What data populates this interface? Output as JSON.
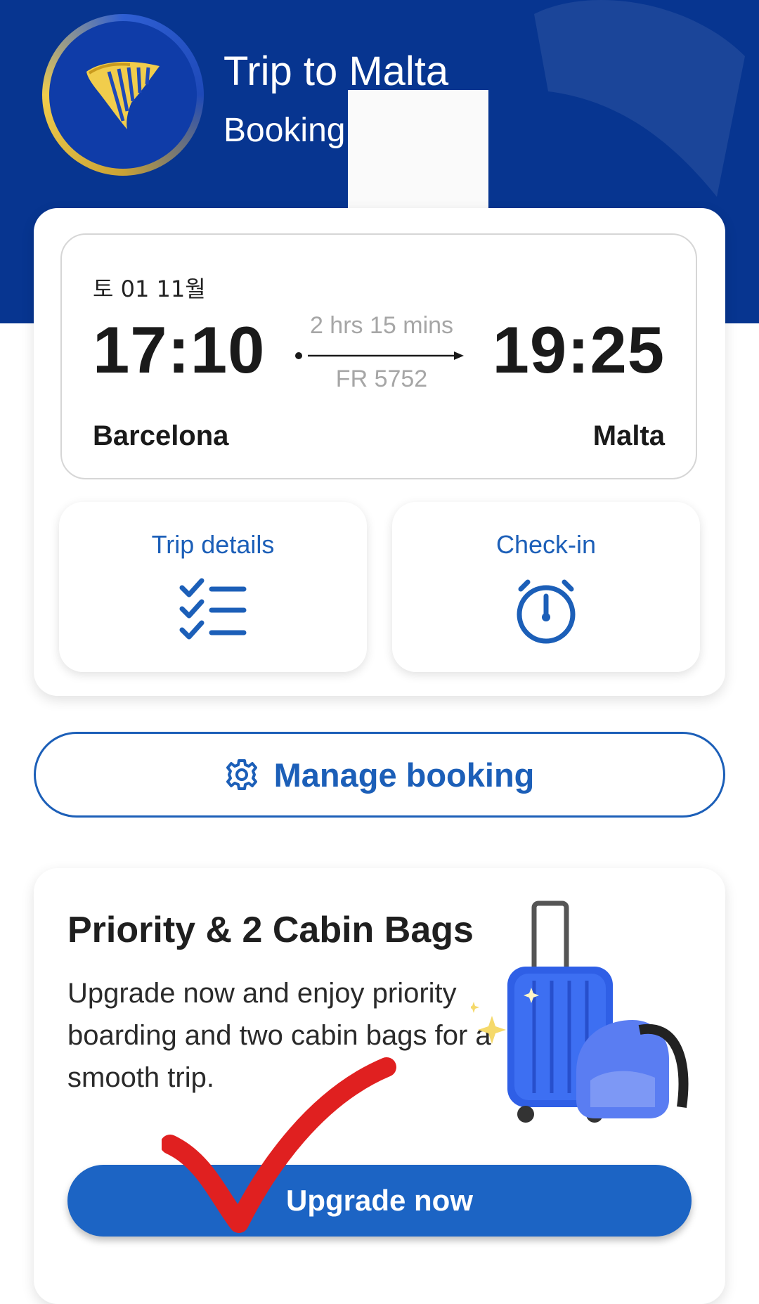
{
  "header": {
    "title": "Trip to Malta",
    "subtitle": "Booking",
    "logo_icon": "ryanair-harp-icon",
    "background_color": "#073590"
  },
  "flight": {
    "date": "토 01 11월",
    "departure_time": "17:10",
    "arrival_time": "19:25",
    "duration": "2 hrs 15 mins",
    "flight_number": "FR 5752",
    "departure_city": "Barcelona",
    "arrival_city": "Malta"
  },
  "tiles": {
    "trip_details": {
      "label": "Trip details",
      "icon": "checklist-icon"
    },
    "check_in": {
      "label": "Check-in",
      "icon": "stopwatch-icon"
    }
  },
  "manage": {
    "label": "Manage booking",
    "icon": "gear-icon"
  },
  "promo": {
    "title": "Priority & 2 Cabin Bags",
    "description": "Upgrade now and enjoy priority boarding and two cabin bags for a smooth trip.",
    "button_label": "Upgrade now",
    "illustration": "luggage-illustration"
  },
  "colors": {
    "brand_blue": "#073590",
    "accent_blue": "#1c5fb8",
    "button_blue": "#1c64c4",
    "gold": "#f1cd4c",
    "annotation_red": "#e02020"
  }
}
